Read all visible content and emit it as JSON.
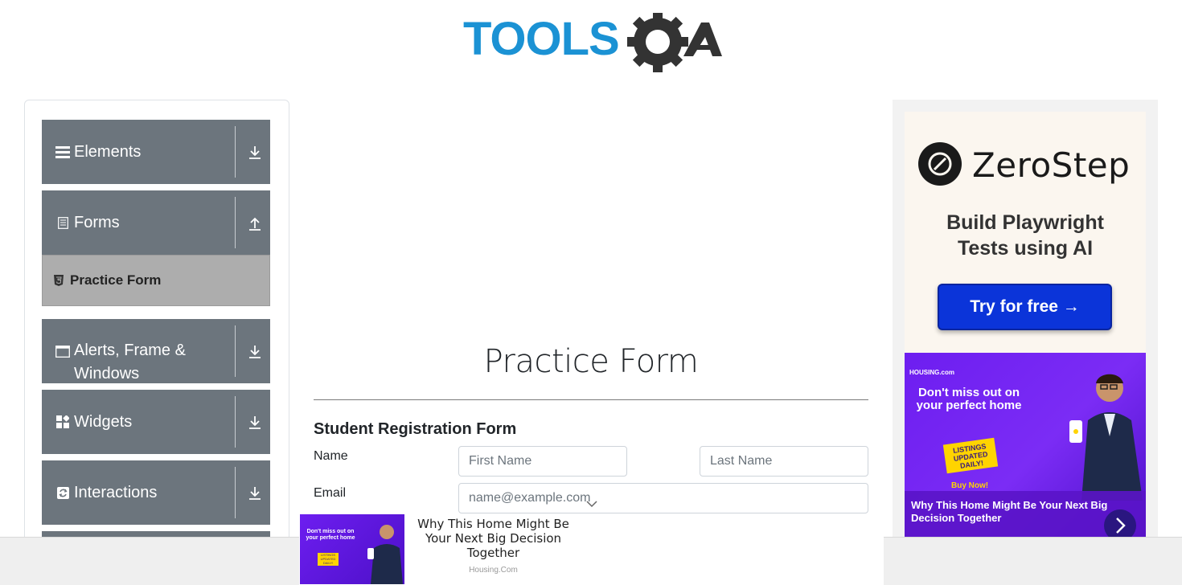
{
  "header": {
    "logo_text_1": "TOOLS",
    "logo_text_2": "QA",
    "logo_color": "#1b92d4",
    "logo_dark": "#333333"
  },
  "sidebar": {
    "groups": [
      {
        "label": "Elements",
        "icon": "hamburger-icon",
        "toggle": "download-icon"
      },
      {
        "label": "Forms",
        "icon": "document-icon",
        "toggle": "upload-icon"
      },
      {
        "label": "Alerts, Frame & Windows",
        "icon": "window-icon",
        "toggle": "download-icon"
      },
      {
        "label": "Widgets",
        "icon": "widgets-icon",
        "toggle": "download-icon"
      },
      {
        "label": "Interactions",
        "icon": "interactions-icon",
        "toggle": "download-icon"
      }
    ],
    "active_item": {
      "label": "Practice Form",
      "icon": "html5-icon"
    }
  },
  "main": {
    "page_title": "Practice Form",
    "form_title": "Student Registration Form",
    "name_label": "Name",
    "first_name_placeholder": "First Name",
    "last_name_placeholder": "Last Name",
    "email_label": "Email",
    "email_placeholder": "name@example.com"
  },
  "ad_right": {
    "brand": "ZeroStep",
    "tagline_1": "Build Playwright",
    "tagline_2": "Tests using AI",
    "button": "Try for free →",
    "promo_brand": "HOUSING.com",
    "promo_head": "Don't miss out on your perfect home",
    "promo_badge": "LISTINGS UPDATED DAILY!",
    "promo_buy": "Buy Now!",
    "promo_caption": "Why This Home Might Be Your Next Big Decision Together"
  },
  "ad_bottom": {
    "headline": "Why This Home Might Be Your Next Big Decision Together",
    "source": "Housing.Com",
    "thumb_head": "Don't miss out on your perfect home",
    "thumb_badge": "LISTINGS UPDATED DAILY!"
  },
  "colors": {
    "sidebar_group": "#6c757d",
    "active_item": "#adadad",
    "cta_blue": "#0b34d9",
    "promo_purple": "#6d1ef0"
  }
}
